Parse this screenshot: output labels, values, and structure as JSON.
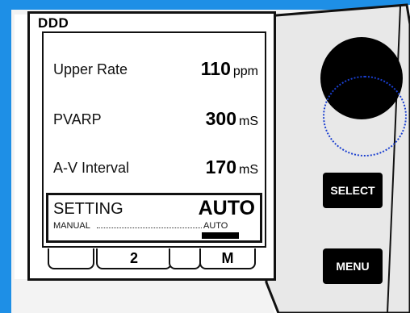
{
  "mode": "DDD",
  "parameters": [
    {
      "label": "Upper Rate",
      "value": "110",
      "unit": "ppm"
    },
    {
      "label": "PVARP",
      "value": "300",
      "unit": "mS"
    },
    {
      "label": "A-V Interval",
      "value": "170",
      "unit": "mS"
    }
  ],
  "setting": {
    "label": "SETTING",
    "state": "AUTO",
    "manual_label": "MANUAL",
    "auto_label": "AUTO"
  },
  "tabs": [
    {
      "label": ""
    },
    {
      "label": "2"
    },
    {
      "label": ""
    },
    {
      "label": "M"
    }
  ],
  "buttons": {
    "select": "SELECT",
    "menu": "MENU"
  },
  "colors": {
    "background": "#1e8fe6",
    "panel": "#e8e8e8",
    "knob_ring": "#1a3fd0"
  },
  "icons": {
    "knob": "rotary-knob-icon"
  }
}
